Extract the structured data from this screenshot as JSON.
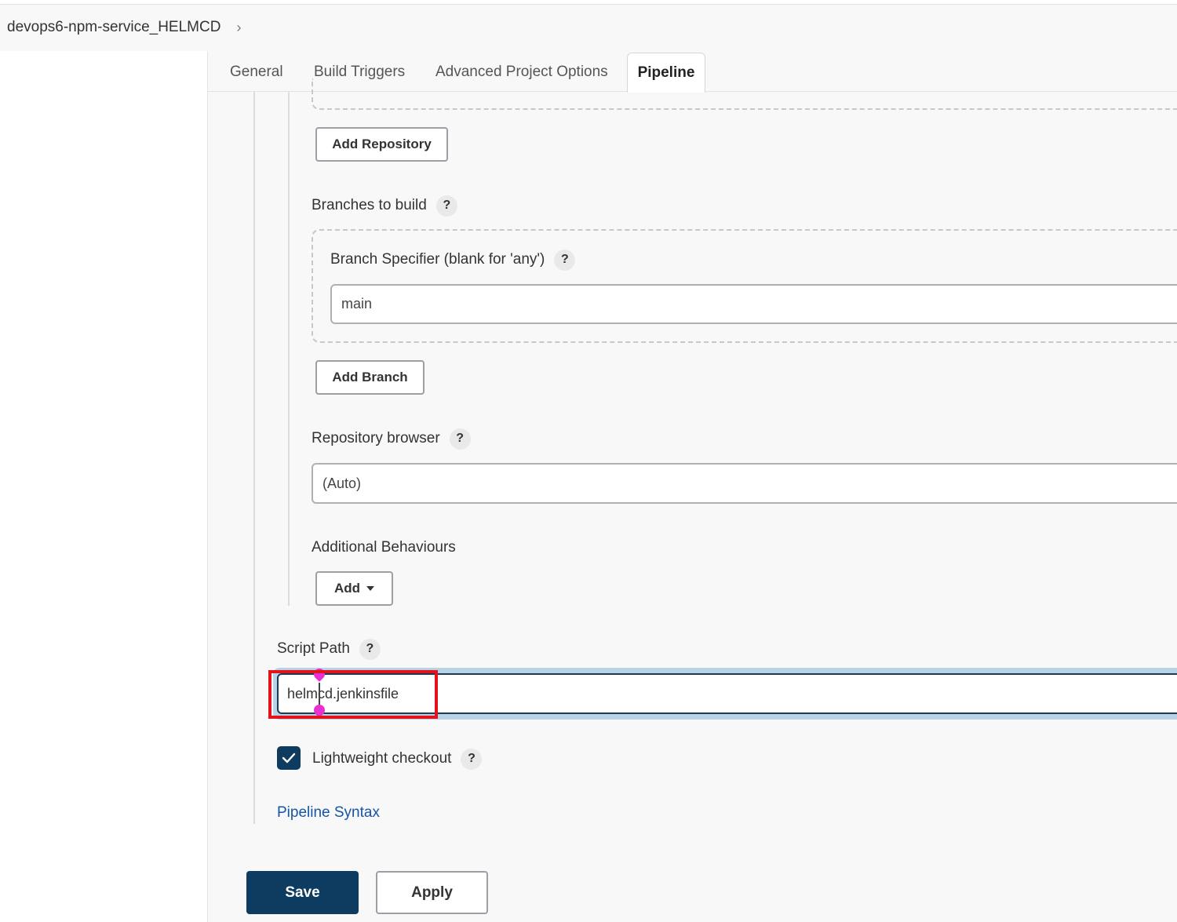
{
  "breadcrumb": {
    "project": "devops6-npm-service_HELMCD",
    "separator": "›"
  },
  "tabs": [
    {
      "label": "General"
    },
    {
      "label": "Build Triggers"
    },
    {
      "label": "Advanced Project Options"
    },
    {
      "label": "Pipeline",
      "active": true
    }
  ],
  "scm": {
    "add_repository_label": "Add Repository",
    "branches_label": "Branches to build",
    "branch_specifier_label": "Branch Specifier (blank for 'any')",
    "branch_specifier_value": "main",
    "add_branch_label": "Add Branch",
    "repo_browser_label": "Repository browser",
    "repo_browser_value": "(Auto)",
    "additional_behaviours_label": "Additional Behaviours",
    "add_label": "Add"
  },
  "script": {
    "label": "Script Path",
    "value": "helmcd.jenkinsfile"
  },
  "lightweight": {
    "label": "Lightweight checkout",
    "checked": true
  },
  "help_glyph": "?",
  "pipeline_syntax_label": "Pipeline Syntax",
  "footer": {
    "save_label": "Save",
    "apply_label": "Apply"
  },
  "colors": {
    "primary": "#0e3c61",
    "link": "#1455a8",
    "highlight": "#e3131b",
    "focus": "#b9d3e6"
  }
}
